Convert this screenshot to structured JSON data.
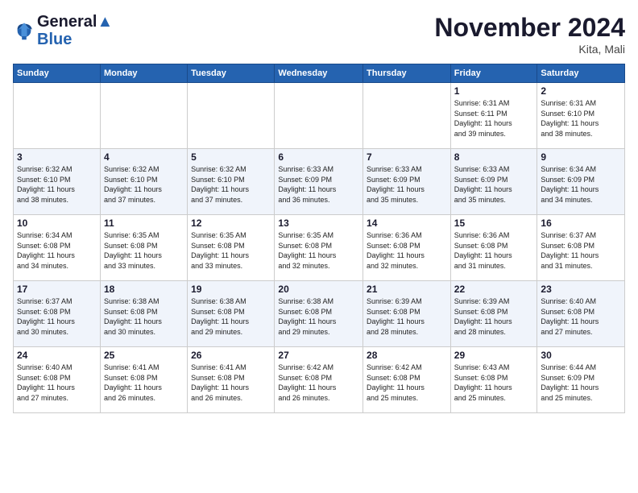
{
  "logo": {
    "line1": "General",
    "line2": "Blue"
  },
  "title": "November 2024",
  "location": "Kita, Mali",
  "days_of_week": [
    "Sunday",
    "Monday",
    "Tuesday",
    "Wednesday",
    "Thursday",
    "Friday",
    "Saturday"
  ],
  "weeks": [
    [
      {
        "day": "",
        "info": ""
      },
      {
        "day": "",
        "info": ""
      },
      {
        "day": "",
        "info": ""
      },
      {
        "day": "",
        "info": ""
      },
      {
        "day": "",
        "info": ""
      },
      {
        "day": "1",
        "info": "Sunrise: 6:31 AM\nSunset: 6:11 PM\nDaylight: 11 hours\nand 39 minutes."
      },
      {
        "day": "2",
        "info": "Sunrise: 6:31 AM\nSunset: 6:10 PM\nDaylight: 11 hours\nand 38 minutes."
      }
    ],
    [
      {
        "day": "3",
        "info": "Sunrise: 6:32 AM\nSunset: 6:10 PM\nDaylight: 11 hours\nand 38 minutes."
      },
      {
        "day": "4",
        "info": "Sunrise: 6:32 AM\nSunset: 6:10 PM\nDaylight: 11 hours\nand 37 minutes."
      },
      {
        "day": "5",
        "info": "Sunrise: 6:32 AM\nSunset: 6:10 PM\nDaylight: 11 hours\nand 37 minutes."
      },
      {
        "day": "6",
        "info": "Sunrise: 6:33 AM\nSunset: 6:09 PM\nDaylight: 11 hours\nand 36 minutes."
      },
      {
        "day": "7",
        "info": "Sunrise: 6:33 AM\nSunset: 6:09 PM\nDaylight: 11 hours\nand 35 minutes."
      },
      {
        "day": "8",
        "info": "Sunrise: 6:33 AM\nSunset: 6:09 PM\nDaylight: 11 hours\nand 35 minutes."
      },
      {
        "day": "9",
        "info": "Sunrise: 6:34 AM\nSunset: 6:09 PM\nDaylight: 11 hours\nand 34 minutes."
      }
    ],
    [
      {
        "day": "10",
        "info": "Sunrise: 6:34 AM\nSunset: 6:08 PM\nDaylight: 11 hours\nand 34 minutes."
      },
      {
        "day": "11",
        "info": "Sunrise: 6:35 AM\nSunset: 6:08 PM\nDaylight: 11 hours\nand 33 minutes."
      },
      {
        "day": "12",
        "info": "Sunrise: 6:35 AM\nSunset: 6:08 PM\nDaylight: 11 hours\nand 33 minutes."
      },
      {
        "day": "13",
        "info": "Sunrise: 6:35 AM\nSunset: 6:08 PM\nDaylight: 11 hours\nand 32 minutes."
      },
      {
        "day": "14",
        "info": "Sunrise: 6:36 AM\nSunset: 6:08 PM\nDaylight: 11 hours\nand 32 minutes."
      },
      {
        "day": "15",
        "info": "Sunrise: 6:36 AM\nSunset: 6:08 PM\nDaylight: 11 hours\nand 31 minutes."
      },
      {
        "day": "16",
        "info": "Sunrise: 6:37 AM\nSunset: 6:08 PM\nDaylight: 11 hours\nand 31 minutes."
      }
    ],
    [
      {
        "day": "17",
        "info": "Sunrise: 6:37 AM\nSunset: 6:08 PM\nDaylight: 11 hours\nand 30 minutes."
      },
      {
        "day": "18",
        "info": "Sunrise: 6:38 AM\nSunset: 6:08 PM\nDaylight: 11 hours\nand 30 minutes."
      },
      {
        "day": "19",
        "info": "Sunrise: 6:38 AM\nSunset: 6:08 PM\nDaylight: 11 hours\nand 29 minutes."
      },
      {
        "day": "20",
        "info": "Sunrise: 6:38 AM\nSunset: 6:08 PM\nDaylight: 11 hours\nand 29 minutes."
      },
      {
        "day": "21",
        "info": "Sunrise: 6:39 AM\nSunset: 6:08 PM\nDaylight: 11 hours\nand 28 minutes."
      },
      {
        "day": "22",
        "info": "Sunrise: 6:39 AM\nSunset: 6:08 PM\nDaylight: 11 hours\nand 28 minutes."
      },
      {
        "day": "23",
        "info": "Sunrise: 6:40 AM\nSunset: 6:08 PM\nDaylight: 11 hours\nand 27 minutes."
      }
    ],
    [
      {
        "day": "24",
        "info": "Sunrise: 6:40 AM\nSunset: 6:08 PM\nDaylight: 11 hours\nand 27 minutes."
      },
      {
        "day": "25",
        "info": "Sunrise: 6:41 AM\nSunset: 6:08 PM\nDaylight: 11 hours\nand 26 minutes."
      },
      {
        "day": "26",
        "info": "Sunrise: 6:41 AM\nSunset: 6:08 PM\nDaylight: 11 hours\nand 26 minutes."
      },
      {
        "day": "27",
        "info": "Sunrise: 6:42 AM\nSunset: 6:08 PM\nDaylight: 11 hours\nand 26 minutes."
      },
      {
        "day": "28",
        "info": "Sunrise: 6:42 AM\nSunset: 6:08 PM\nDaylight: 11 hours\nand 25 minutes."
      },
      {
        "day": "29",
        "info": "Sunrise: 6:43 AM\nSunset: 6:08 PM\nDaylight: 11 hours\nand 25 minutes."
      },
      {
        "day": "30",
        "info": "Sunrise: 6:44 AM\nSunset: 6:09 PM\nDaylight: 11 hours\nand 25 minutes."
      }
    ]
  ]
}
